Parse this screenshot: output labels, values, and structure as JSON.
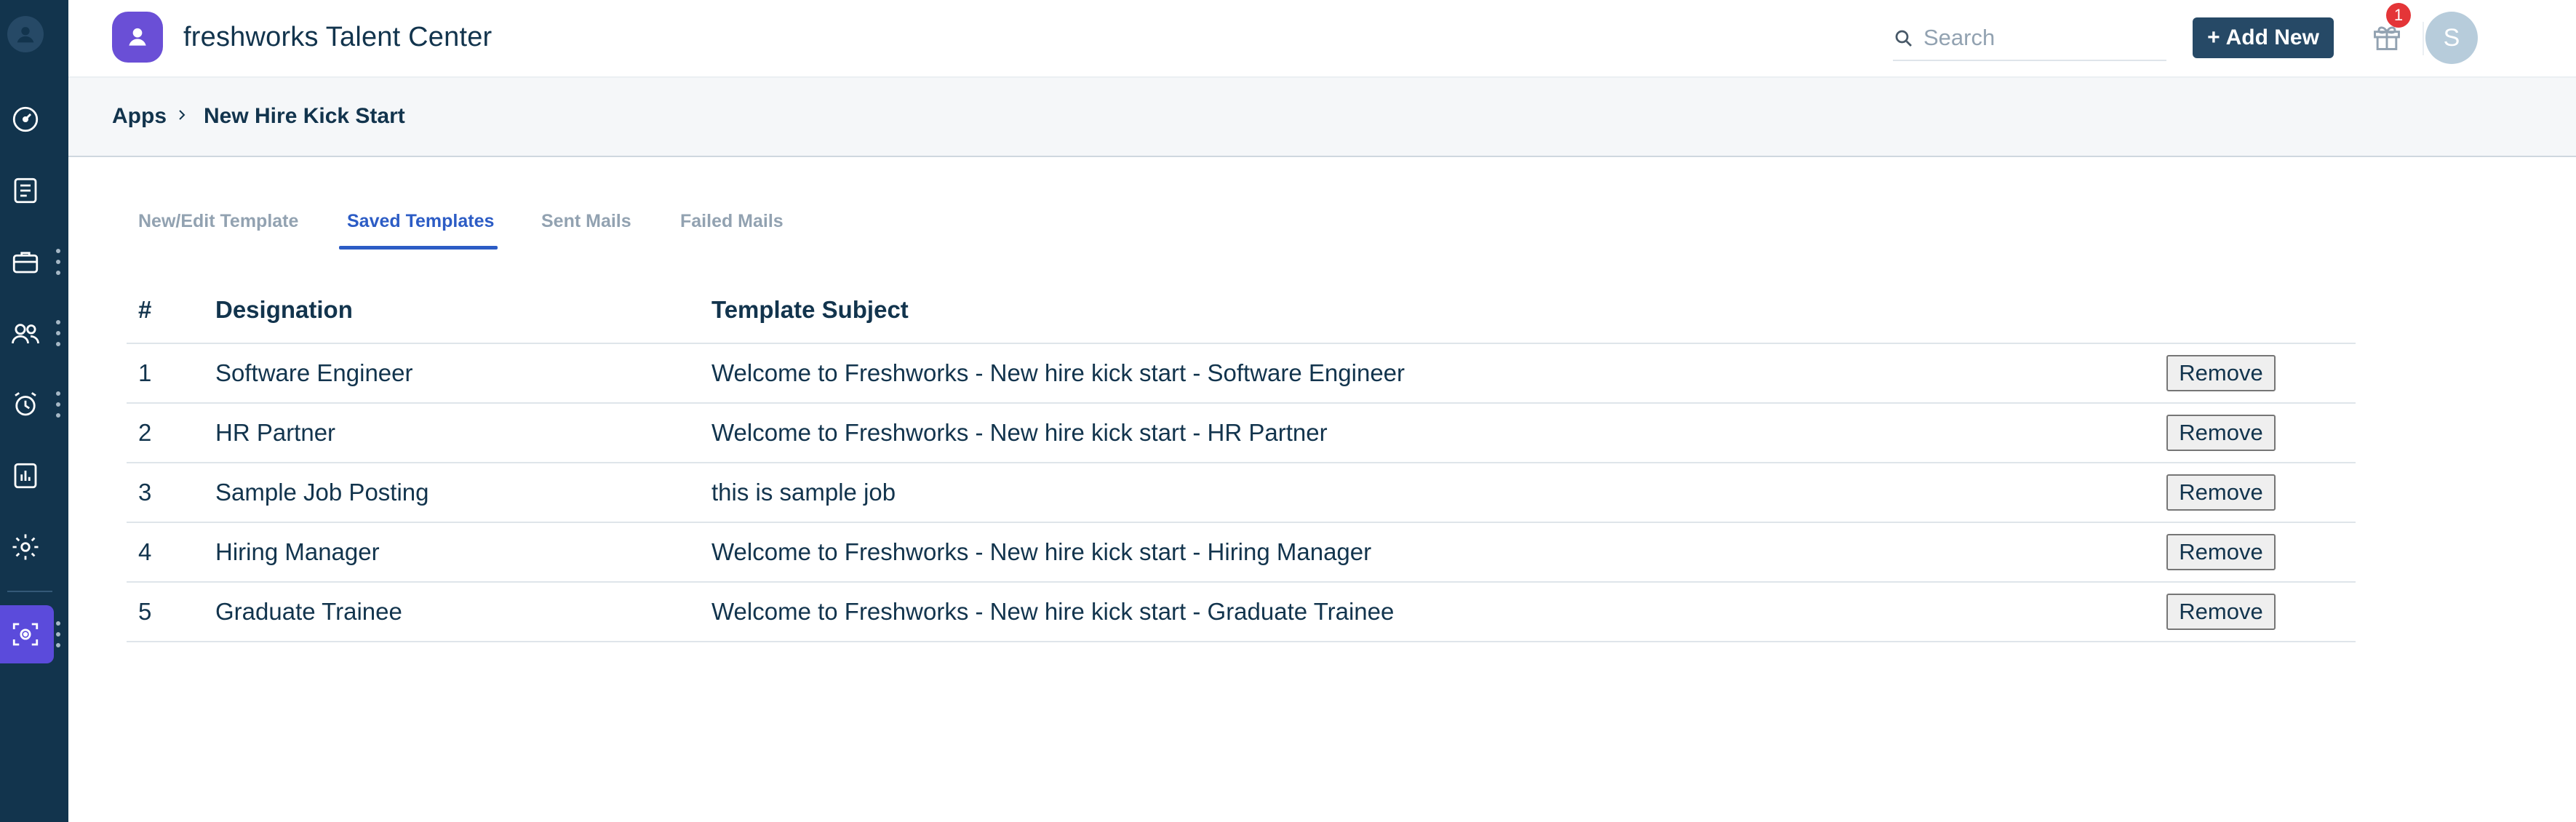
{
  "app": {
    "title": "freshworks Talent Center"
  },
  "header": {
    "search_placeholder": "Search",
    "add_new_label": "Add New",
    "notification_count": "1",
    "avatar_initial": "S"
  },
  "breadcrumb": {
    "root": "Apps",
    "current": "New Hire Kick Start"
  },
  "tabs": [
    {
      "label": "New/Edit Template",
      "active": false
    },
    {
      "label": "Saved Templates",
      "active": true
    },
    {
      "label": "Sent Mails",
      "active": false
    },
    {
      "label": "Failed Mails",
      "active": false
    }
  ],
  "table": {
    "headers": [
      "#",
      "Designation",
      "Template Subject",
      ""
    ],
    "remove_label": "Remove",
    "rows": [
      {
        "num": "1",
        "designation": "Software Engineer",
        "subject": "Welcome to Freshworks - New hire kick start - Software Engineer"
      },
      {
        "num": "2",
        "designation": "HR Partner",
        "subject": "Welcome to Freshworks - New hire kick start - HR Partner"
      },
      {
        "num": "3",
        "designation": "Sample Job Posting",
        "subject": "this is sample job"
      },
      {
        "num": "4",
        "designation": "Hiring Manager",
        "subject": "Welcome to Freshworks - New hire kick start - Hiring Manager"
      },
      {
        "num": "5",
        "designation": "Graduate Trainee",
        "subject": "Welcome to Freshworks - New hire kick start - Graduate Trainee"
      }
    ]
  },
  "sidebar": {
    "icons": [
      "user-logo-icon",
      "dashboard-icon",
      "tasks-icon",
      "briefcase-icon",
      "people-icon",
      "alarm-clock-icon",
      "reports-icon",
      "settings-icon",
      "apps-icon"
    ]
  },
  "colors": {
    "sidebar_bg": "#12344d",
    "accent": "#2c5cc5",
    "brand": "#6a4fd6",
    "primary_button": "#264966",
    "active_app": "#5b4bdb",
    "badge": "#e43538"
  }
}
